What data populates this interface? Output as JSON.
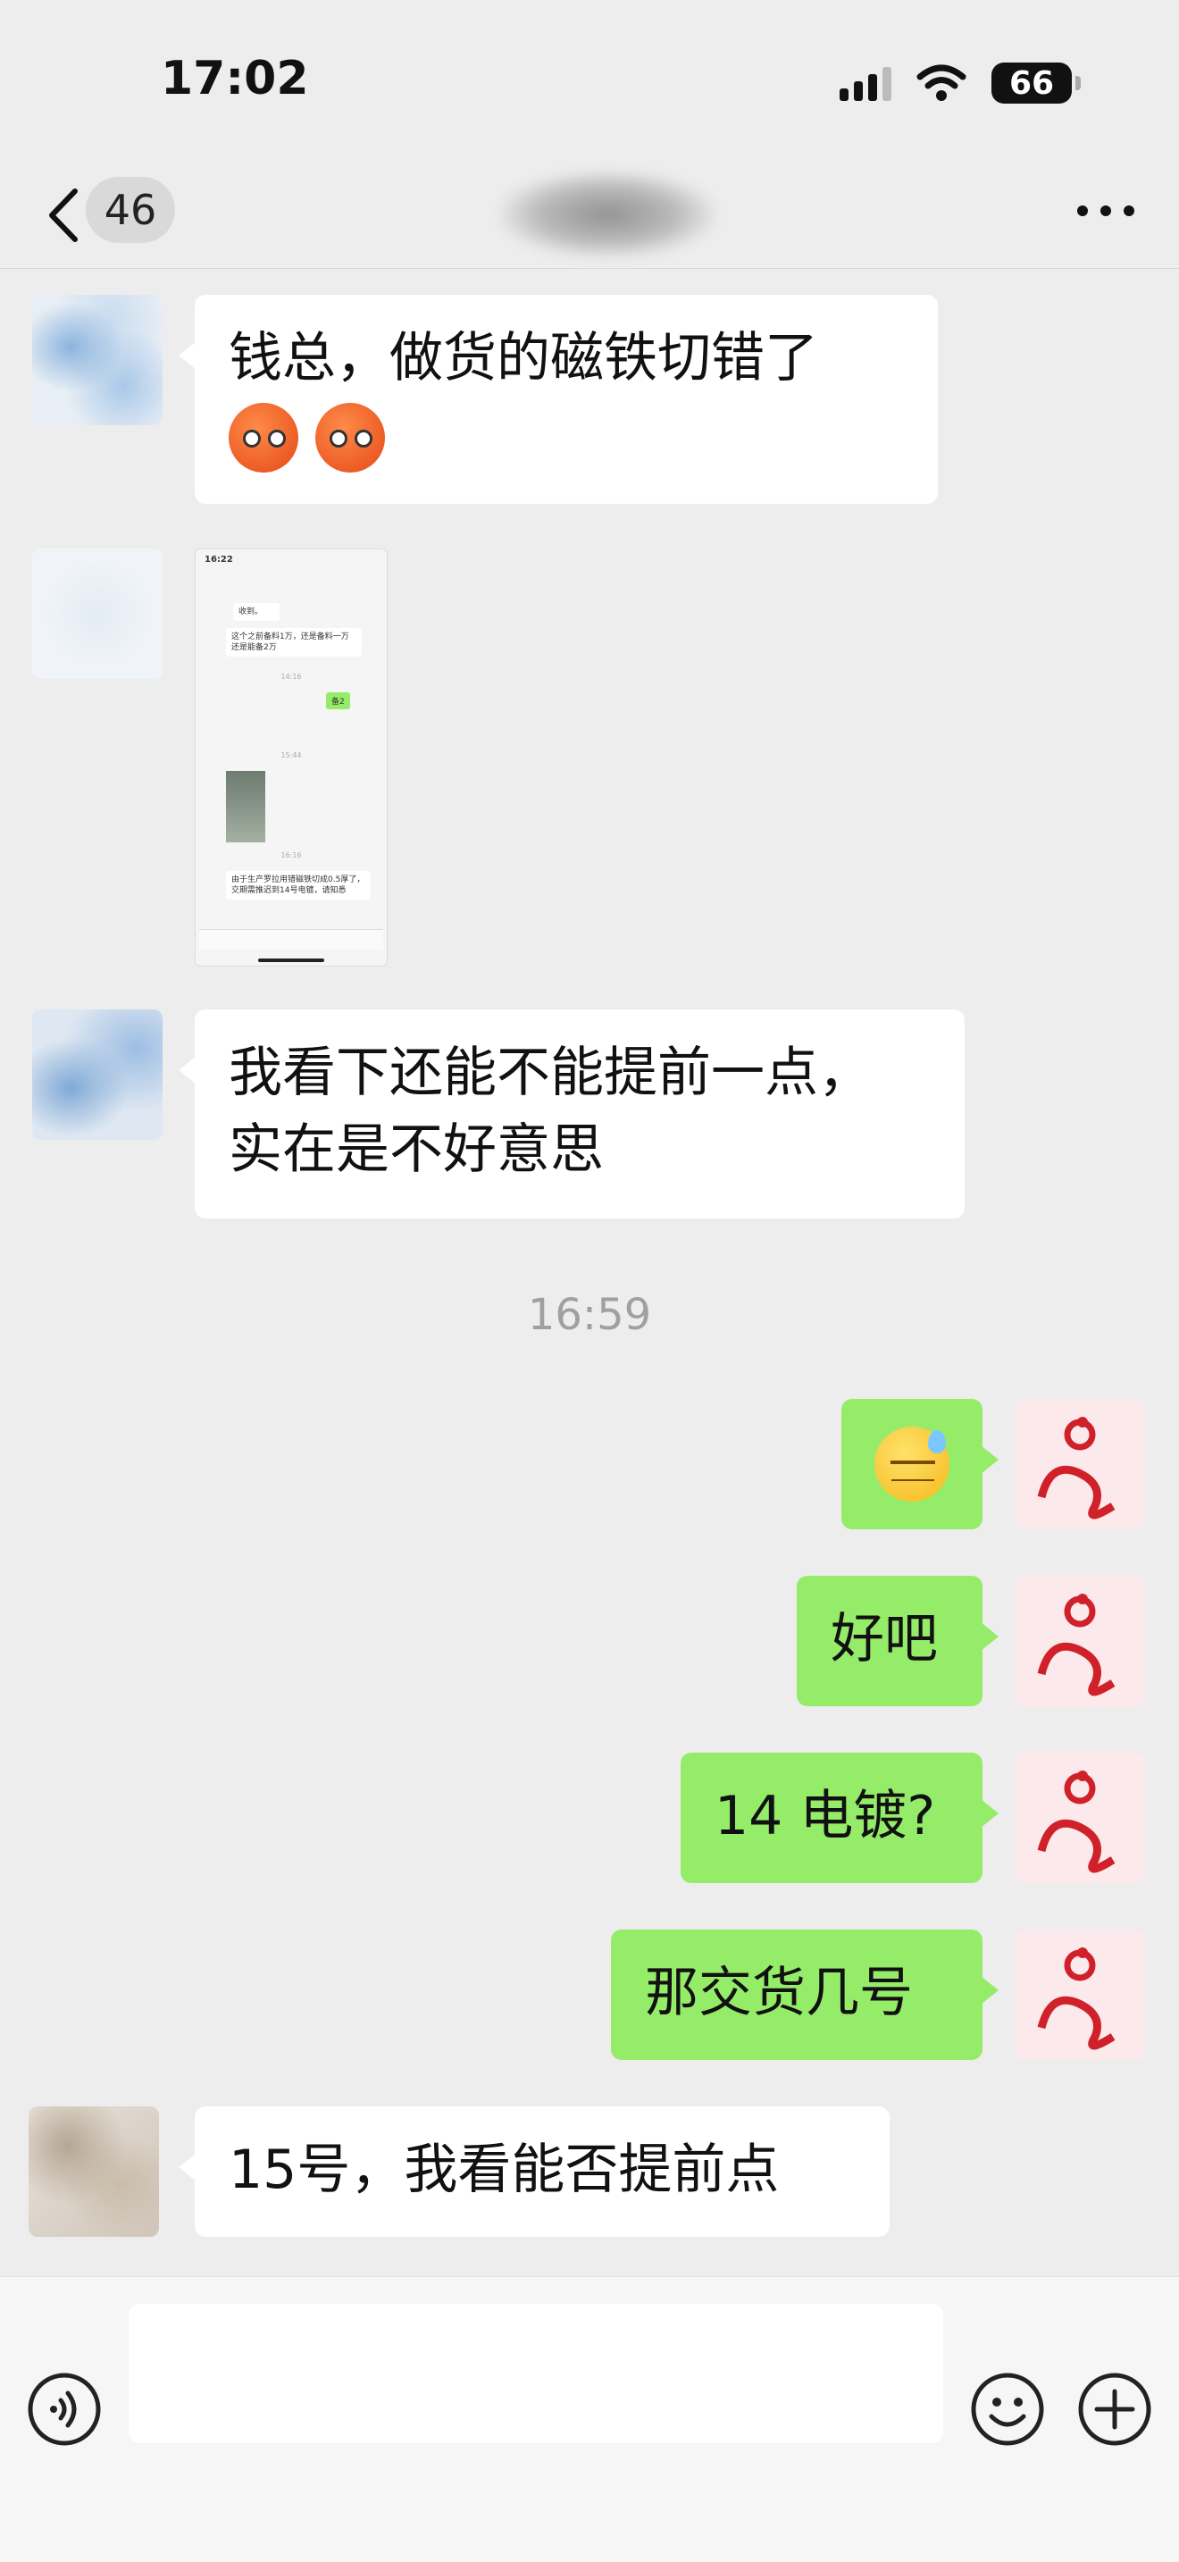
{
  "status_bar": {
    "time": "17:02",
    "battery": "66"
  },
  "nav": {
    "unread_count": "46"
  },
  "messages": [
    {
      "text": "钱总，做货的磁铁切错了"
    },
    {
      "type": "image",
      "thumb": {
        "time": "16:22",
        "msg1": "收到。",
        "msg2": "这个之前备料1万，还是备料一万还是能备2万",
        "time2": "14:16",
        "reply": "备2",
        "time3": "15:44",
        "time4": "16:16",
        "msg3": "由于生产罗拉用错磁铁切成0.5厚了，交期需推迟到14号电镀，请知悉"
      }
    },
    {
      "text": "我看下还能不能提前一点，实在是不好意思",
      "line1": "我看下还能不能提前一点，",
      "line2": "实在是不好意思"
    },
    {
      "timestamp": "16:59"
    },
    {
      "type": "emoji",
      "emoji": "sweat-face"
    },
    {
      "text": "好吧"
    },
    {
      "text": "14 电镀?"
    },
    {
      "text": "那交货几号"
    },
    {
      "text": "15号，我看能否提前点"
    }
  ],
  "colors": {
    "sent_bubble": "#95ec69",
    "received_bubble": "#ffffff",
    "background": "#ededed"
  }
}
